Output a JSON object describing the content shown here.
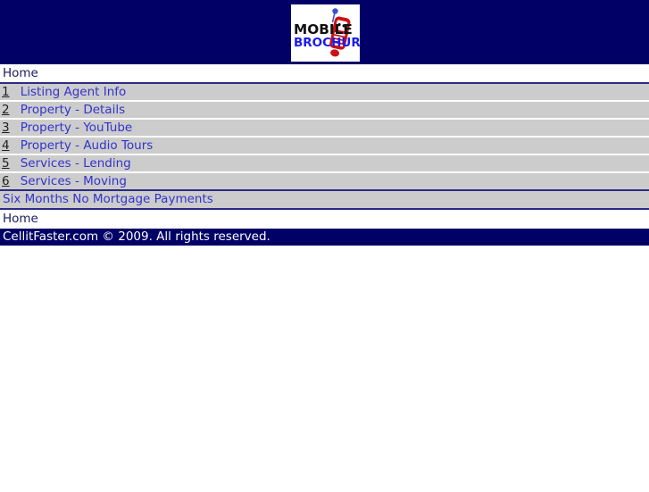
{
  "header": {
    "logo": {
      "name": "mobile-brochure-logo",
      "line1": "MOBILE",
      "line2": "BROCHURE",
      "line1_color": "#111111",
      "line2_color": "#1a1aee",
      "phone_color": "#cc1111",
      "antenna_color": "#3a4fd8",
      "background": "#ffffff"
    },
    "banner_color": "#000066"
  },
  "breadcrumb_top": {
    "label": "Home"
  },
  "menu": {
    "items": [
      {
        "key": "1",
        "label": "Listing Agent Info"
      },
      {
        "key": "2",
        "label": "Property - Details"
      },
      {
        "key": "3",
        "label": "Property - YouTube"
      },
      {
        "key": "4",
        "label": "Property - Audio Tours"
      },
      {
        "key": "5",
        "label": "Services - Lending"
      },
      {
        "key": "6",
        "label": "Services - Moving"
      }
    ],
    "row_background": "#cccccc",
    "link_color": "#3333cc"
  },
  "promo": {
    "label": "Six Months No Mortgage Payments"
  },
  "breadcrumb_bottom": {
    "label": "Home"
  },
  "footer": {
    "text": "CellitFaster.com © 2009. All rights reserved.",
    "background": "#000066",
    "text_color": "#ffffff"
  }
}
